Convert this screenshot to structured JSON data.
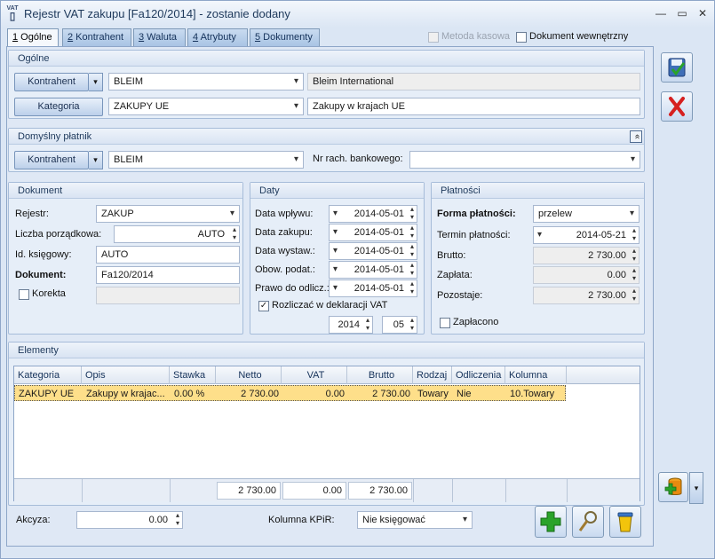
{
  "window": {
    "icon_label": "VAT",
    "title": "Rejestr VAT zakupu [Fa120/2014] - zostanie dodany",
    "minimize": "—",
    "maximize": "▭",
    "close": "✕"
  },
  "tabs": [
    {
      "key": "1",
      "label": " Ogólne"
    },
    {
      "key": "2",
      "label": " Kontrahent"
    },
    {
      "key": "3",
      "label": " Waluta"
    },
    {
      "key": "4",
      "label": " Atrybuty"
    },
    {
      "key": "5",
      "label": " Dokumenty"
    }
  ],
  "header_checks": {
    "metoda_kasowa": {
      "label": "Metoda kasowa",
      "checked": false,
      "enabled": false
    },
    "dokument_wewnetrzny": {
      "label": "Dokument wewnętrzny",
      "checked": false
    }
  },
  "ogolne": {
    "title": "Ogólne",
    "kontrahent_button": "Kontrahent",
    "kontrahent_code": "BLEIM",
    "kontrahent_name": "Bleim International",
    "kategoria_button": "Kategoria",
    "kategoria_code": "ZAKUPY UE",
    "kategoria_desc": "Zakupy w krajach UE"
  },
  "platnik": {
    "title": "Domyślny płatnik",
    "kontrahent_button": "Kontrahent",
    "code": "BLEIM",
    "bank_label": "Nr rach. bankowego:",
    "bank_value": "",
    "collapse_icon": "«"
  },
  "dokument": {
    "title": "Dokument",
    "rejestr_label": "Rejestr:",
    "rejestr_value": "ZAKUP",
    "liczba_label": "Liczba porządkowa:",
    "liczba_value": "AUTO",
    "id_label": "Id. księgowy:",
    "id_value": "AUTO",
    "dok_label": "Dokument:",
    "dok_value": "Fa120/2014",
    "korekta_label": "Korekta",
    "korekta_checked": false
  },
  "daty": {
    "title": "Daty",
    "wplywu_label": "Data wpływu:",
    "wplywu_value": "2014-05-01",
    "zakupu_label": "Data zakupu:",
    "zakupu_value": "2014-05-01",
    "wystaw_label": "Data wystaw.:",
    "wystaw_value": "2014-05-01",
    "obow_label": "Obow. podat.:",
    "obow_value": "2014-05-01",
    "prawo_label": "Prawo do odlicz.:",
    "prawo_value": "2014-05-01",
    "rozliczac_label": "Rozliczać w deklaracji VAT",
    "rozliczac_checked": true,
    "year": "2014",
    "month": "05"
  },
  "platnosci": {
    "title": "Płatności",
    "forma_label": "Forma płatności:",
    "forma_value": "przelew",
    "termin_label": "Termin płatności:",
    "termin_value": "2014-05-21",
    "brutto_label": "Brutto:",
    "brutto_value": "2 730.00",
    "zaplata_label": "Zapłata:",
    "zaplata_value": "0.00",
    "pozostaje_label": "Pozostaje:",
    "pozostaje_value": "2 730.00",
    "zaplacono_label": "Zapłacono",
    "zaplacono_checked": false
  },
  "elementy": {
    "title": "Elementy",
    "columns": [
      "Kategoria",
      "Opis",
      "Stawka",
      "Netto",
      "VAT",
      "Brutto",
      "Rodzaj",
      "Odliczenia",
      "Kolumna"
    ],
    "rows": [
      {
        "kategoria": "ZAKUPY UE",
        "opis": "Zakupy w krajac...",
        "stawka": "0.00  %",
        "netto": "2 730.00",
        "vat": "0.00",
        "brutto": "2 730.00",
        "rodzaj": "Towary",
        "odliczenia": "Nie",
        "kolumna": "10.Towary"
      }
    ],
    "totals": {
      "netto": "2 730.00",
      "vat": "0.00",
      "brutto": "2 730.00"
    }
  },
  "bottom": {
    "akcyza_label": "Akcyza:",
    "akcyza_value": "0.00",
    "kpir_label": "Kolumna KPiR:",
    "kpir_value": "Nie księgować"
  },
  "colors": {
    "accent": "#1e395b",
    "selection": "#fedf8a",
    "cancel": "#d62020",
    "add": "#2aa32a"
  }
}
